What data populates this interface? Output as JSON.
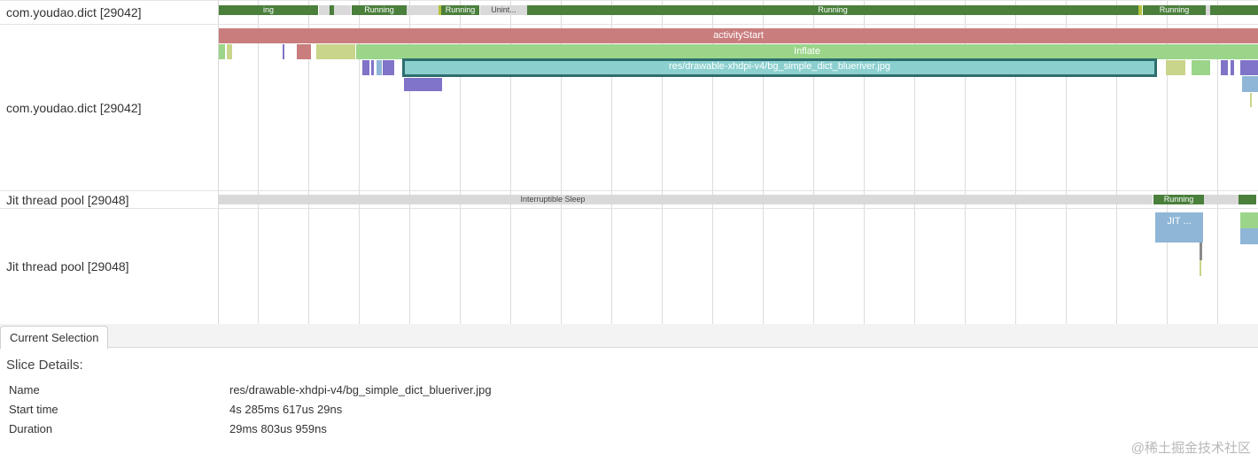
{
  "tracks": {
    "proc_name": "com.youdao.dict [29042]",
    "proc_main_name": "com.youdao.dict [29042]",
    "jit_name": "Jit thread pool [29048]",
    "jit_main_name": "Jit thread pool [29048]"
  },
  "states": {
    "running": "Running",
    "ing": "ing",
    "unint": "Unint...",
    "interruptible_sleep": "Interruptible Sleep"
  },
  "slices": {
    "activity_start": "activityStart",
    "inflate": "Inflate",
    "selected_res": "res/drawable-xhdpi-v4/bg_simple_dict_blueriver.jpg",
    "jit": "JIT ..."
  },
  "panel": {
    "tab_label": "Current Selection",
    "title": "Slice Details:",
    "rows": [
      {
        "key": "Name",
        "value": "res/drawable-xhdpi-v4/bg_simple_dict_blueriver.jpg"
      },
      {
        "key": "Start time",
        "value": "4s 285ms 617us 29ns"
      },
      {
        "key": "Duration",
        "value": "29ms 803us 959ns"
      }
    ]
  },
  "watermark": "@稀土掘金技术社区",
  "colors": {
    "running": "#4a7f3c",
    "sleep": "#d9d9d9",
    "activity_start": "#c97d7d",
    "inflate": "#9bd58a",
    "selected": "#8bcfcf",
    "jit": "#8fb6d6",
    "purple": "#7f74c7"
  }
}
